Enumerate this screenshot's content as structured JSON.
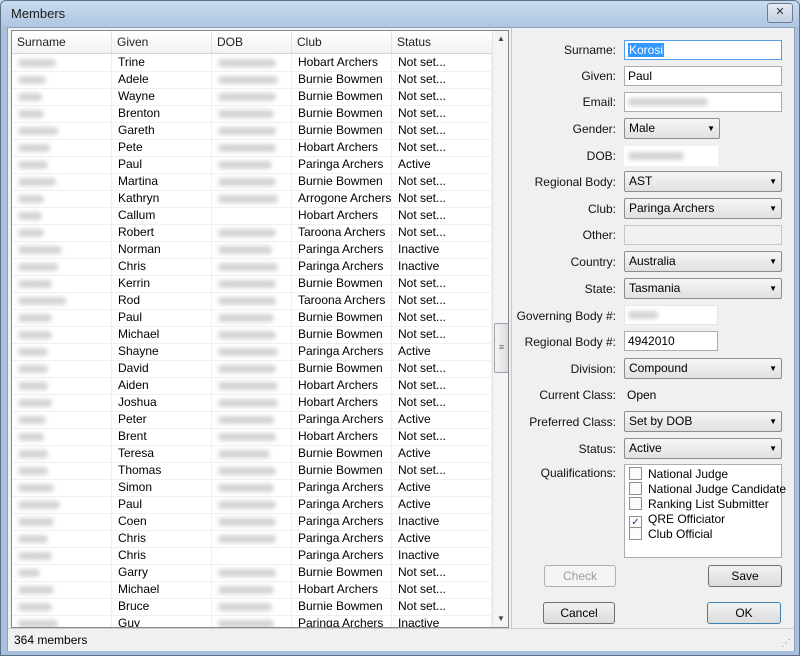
{
  "window": {
    "title": "Members",
    "close_glyph": "✕"
  },
  "table": {
    "columns": [
      "Surname",
      "Given",
      "DOB",
      "Club",
      "Status"
    ],
    "rows": [
      {
        "given": "Trine",
        "club": "Hobart Archers",
        "status": "Not set..."
      },
      {
        "given": "Adele",
        "club": "Burnie Bowmen",
        "status": "Not set..."
      },
      {
        "given": "Wayne",
        "club": "Burnie Bowmen",
        "status": "Not set..."
      },
      {
        "given": "Brenton",
        "club": "Burnie Bowmen",
        "status": "Not set..."
      },
      {
        "given": "Gareth",
        "club": "Burnie Bowmen",
        "status": "Not set..."
      },
      {
        "given": "Pete",
        "club": "Hobart Archers",
        "status": "Not set..."
      },
      {
        "given": "Paul",
        "club": "Paringa Archers",
        "status": "Active"
      },
      {
        "given": "Martina",
        "club": "Burnie Bowmen",
        "status": "Not set..."
      },
      {
        "given": "Kathryn",
        "club": "Arrogone Archers",
        "status": "Not set..."
      },
      {
        "given": "Callum",
        "club": "Hobart Archers",
        "status": "Not set..."
      },
      {
        "given": "Robert",
        "club": "Taroona Archers",
        "status": "Not set..."
      },
      {
        "given": "Norman",
        "club": "Paringa Archers",
        "status": "Inactive"
      },
      {
        "given": "Chris",
        "club": "Paringa Archers",
        "status": "Inactive"
      },
      {
        "given": "Kerrin",
        "club": "Burnie Bowmen",
        "status": "Not set..."
      },
      {
        "given": "Rod",
        "club": "Taroona Archers",
        "status": "Not set..."
      },
      {
        "given": "Paul",
        "club": "Burnie Bowmen",
        "status": "Not set..."
      },
      {
        "given": "Michael",
        "club": "Burnie Bowmen",
        "status": "Not set..."
      },
      {
        "given": "Shayne",
        "club": "Paringa Archers",
        "status": "Active"
      },
      {
        "given": "David",
        "club": "Burnie Bowmen",
        "status": "Not set..."
      },
      {
        "given": "Aiden",
        "club": "Hobart Archers",
        "status": "Not set..."
      },
      {
        "given": "Joshua",
        "club": "Hobart Archers",
        "status": "Not set..."
      },
      {
        "given": "Peter",
        "club": "Paringa Archers",
        "status": "Active"
      },
      {
        "given": "Brent",
        "club": "Hobart Archers",
        "status": "Not set..."
      },
      {
        "given": "Teresa",
        "club": "Burnie Bowmen",
        "status": "Active"
      },
      {
        "given": "Thomas",
        "club": "Burnie Bowmen",
        "status": "Not set..."
      },
      {
        "given": "Simon",
        "club": "Paringa Archers",
        "status": "Active"
      },
      {
        "given": "Paul",
        "club": "Paringa Archers",
        "status": "Active"
      },
      {
        "given": "Coen",
        "club": "Paringa Archers",
        "status": "Inactive"
      },
      {
        "given": "Chris",
        "club": "Paringa Archers",
        "status": "Active"
      },
      {
        "given": "Chris",
        "club": "Paringa Archers",
        "status": "Inactive"
      },
      {
        "given": "Garry",
        "club": "Burnie Bowmen",
        "status": "Not set..."
      },
      {
        "given": "Michael",
        "club": "Hobart Archers",
        "status": "Not set..."
      },
      {
        "given": "Bruce",
        "club": "Burnie Bowmen",
        "status": "Not set..."
      },
      {
        "given": "Guy",
        "club": "Paringa Archers",
        "status": "Inactive"
      }
    ]
  },
  "statusbar": {
    "text": "364 members"
  },
  "form": {
    "surname": {
      "label": "Surname:",
      "value": "Korosi"
    },
    "given": {
      "label": "Given:",
      "value": "Paul"
    },
    "email": {
      "label": "Email:"
    },
    "gender": {
      "label": "Gender:",
      "value": "Male"
    },
    "dob": {
      "label": "DOB:"
    },
    "regional_body": {
      "label": "Regional Body:",
      "value": "AST"
    },
    "club": {
      "label": "Club:",
      "value": "Paringa Archers"
    },
    "other": {
      "label": "Other:",
      "value": ""
    },
    "country": {
      "label": "Country:",
      "value": "Australia"
    },
    "state": {
      "label": "State:",
      "value": "Tasmania"
    },
    "governing_body_no": {
      "label": "Governing Body #:"
    },
    "regional_body_no": {
      "label": "Regional Body #:",
      "value": "4942010"
    },
    "division": {
      "label": "Division:",
      "value": "Compound"
    },
    "current_class": {
      "label": "Current Class:",
      "value": "Open"
    },
    "preferred_class": {
      "label": "Preferred Class:",
      "value": "Set by DOB"
    },
    "status": {
      "label": "Status:",
      "value": "Active"
    },
    "qualifications": {
      "label": "Qualifications:",
      "items": [
        {
          "label": "National Judge",
          "checked": false
        },
        {
          "label": "National Judge Candidate",
          "checked": false
        },
        {
          "label": "Ranking List Submitter",
          "checked": false
        },
        {
          "label": "QRE Officiator",
          "checked": true
        },
        {
          "label": "Club Official",
          "checked": false
        }
      ]
    }
  },
  "buttons": {
    "check": "Check",
    "save": "Save",
    "cancel": "Cancel",
    "ok": "OK"
  },
  "glyphs": {
    "dropdown_arrow": "▼",
    "scroll_up": "▲",
    "scroll_down": "▼",
    "thumb_grip": "≡",
    "check_mark": "✓",
    "resize_grip": "⋰"
  }
}
